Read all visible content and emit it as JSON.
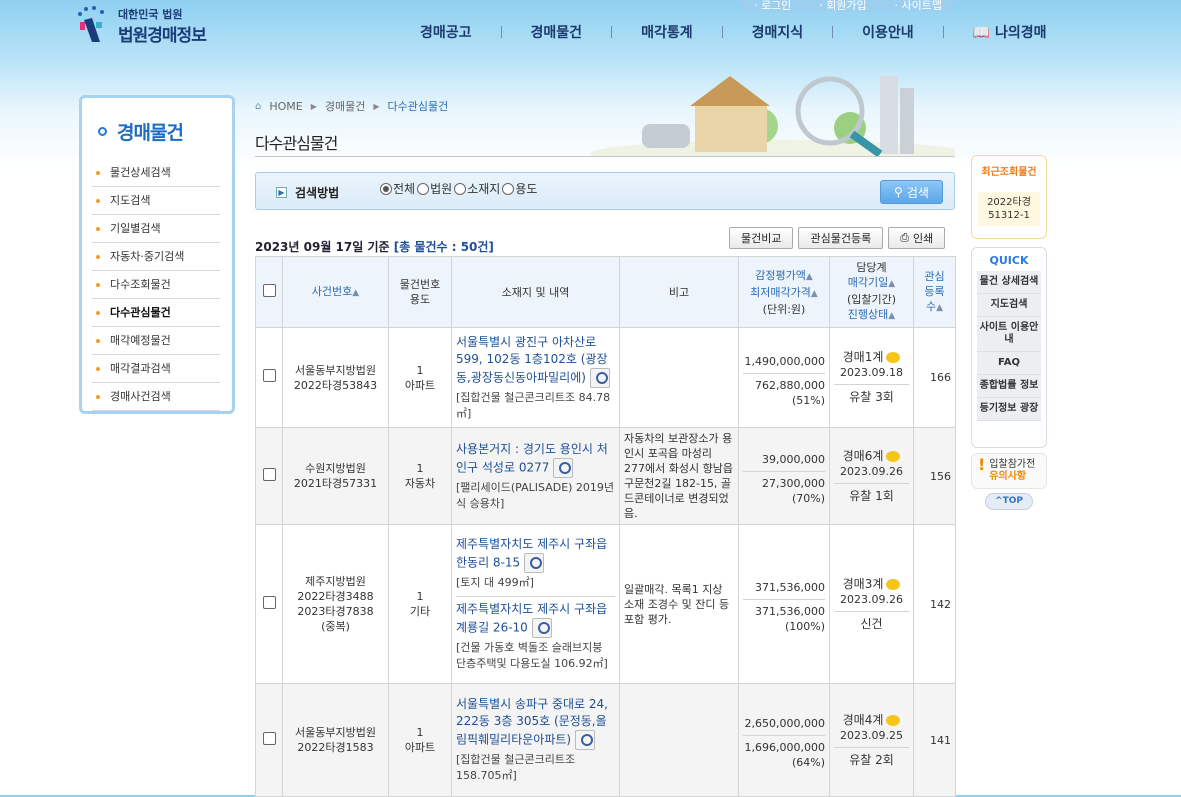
{
  "header": {
    "logo_small": "대한민국 법원",
    "logo_big": "법원경매정보",
    "top_links": [
      "로그인",
      "회원가입",
      "사이트맵"
    ],
    "nav": [
      "경매공고",
      "경매물건",
      "매각통계",
      "경매지식",
      "이용안내",
      "나의경매"
    ]
  },
  "sidebar": {
    "title": "경매물건",
    "items": [
      "물건상세검색",
      "지도검색",
      "기일별검색",
      "자동차·중기검색",
      "다수조회물건",
      "다수관심물건",
      "매각예정물건",
      "매각결과검색",
      "경매사건검색"
    ],
    "active_index": 5
  },
  "breadcrumb": [
    "HOME",
    "경매물건",
    "다수관심물건"
  ],
  "page_title": "다수관심물건",
  "search": {
    "label": "검색방법",
    "options": [
      "전체",
      "법원",
      "소재지",
      "용도"
    ],
    "selected": "전체",
    "button": "검색"
  },
  "summary": {
    "date": "2023년 09월 17일 기준",
    "count": "[총 물건수 : 50건]"
  },
  "actions": {
    "compare": "물건비교",
    "register": "관심물건등록",
    "print": "인쇄"
  },
  "table": {
    "headers": {
      "case": "사건번호",
      "item_no": "물건번호",
      "use": "용도",
      "location": "소재지 및 내역",
      "note": "비고",
      "appraisal": "감정평가액",
      "min_price": "최저매각가격",
      "unit": "(단위:원)",
      "dept": "담당계",
      "sale_date": "매각기일",
      "period": "(입찰기간)",
      "status": "진행상태",
      "interest": "관심",
      "interest2": "등록",
      "interest3": "수"
    },
    "rows": [
      {
        "court": "서울동부지방법원",
        "case_nos": [
          "2022타경53843"
        ],
        "item_no": "1",
        "use": "아파트",
        "locations": [
          {
            "addr": "서울특별시 광진구 아차산로 599, 102동 1층102호 (광장동,광장동신동아파밀리에)",
            "desc": "[집합건물 철근콘크리트조 84.78㎡]"
          }
        ],
        "note": "",
        "appraisal": "1,490,000,000",
        "min_price": "762,880,000",
        "ratio": "(51%)",
        "dept": "경매1계",
        "date": "2023.09.18",
        "status": "유찰 3회",
        "interest": "166"
      },
      {
        "court": "수원지방법원",
        "case_nos": [
          "2021타경57331"
        ],
        "item_no": "1",
        "use": "자동차",
        "locations": [
          {
            "addr": "사용본거지 : 경기도 용인시 처인구 석성로 0277",
            "desc": "[팰리세이드(PALISADE) 2019년식 승용차]"
          }
        ],
        "note": "자동차의 보관장소가 용인시 포곡읍 마성리 277에서 화성시 향남읍 구문천2길 182-15, 골드콘테이너로 변경되었음.",
        "appraisal": "39,000,000",
        "min_price": "27,300,000",
        "ratio": "(70%)",
        "dept": "경매6계",
        "date": "2023.09.26",
        "status": "유찰 1회",
        "interest": "156"
      },
      {
        "court": "제주지방법원",
        "case_nos": [
          "2022타경3488",
          "2023타경7838",
          "(중복)"
        ],
        "item_no": "1",
        "use": "기타",
        "locations": [
          {
            "addr": "제주특별자치도 제주시 구좌읍 한동리 8-15",
            "desc": "[토지 대 499㎡]"
          },
          {
            "addr": "제주특별자치도 제주시 구좌읍 계룡길 26-10",
            "desc": "[건물 가동호 벽돌조 슬래브지붕 단층주택및 다용도실 106.92㎡]"
          }
        ],
        "note": "일괄매각. 목록1 지상 소재 조경수 및 잔디 등 포함 평가.",
        "appraisal": "371,536,000",
        "min_price": "371,536,000",
        "ratio": "(100%)",
        "dept": "경매3계",
        "date": "2023.09.26",
        "status": "신건",
        "interest": "142"
      },
      {
        "court": "서울동부지방법원",
        "case_nos": [
          "2022타경1583"
        ],
        "item_no": "1",
        "use": "아파트",
        "locations": [
          {
            "addr": "서울특별시 송파구 중대로 24, 222동 3층 305호 (문정동,올림픽훼밀리타운아파트)",
            "desc": "[집합건물 철근콘크리트조 158.705㎡]"
          }
        ],
        "note": "",
        "appraisal": "2,650,000,000",
        "min_price": "1,696,000,000",
        "ratio": "(64%)",
        "dept": "경매4계",
        "date": "2023.09.25",
        "status": "유찰 2회",
        "interest": "141"
      }
    ]
  },
  "right": {
    "recent_title": "최근조회물건",
    "recent_value": "2022타경 51312-1",
    "quick_title": "QUICK",
    "quick_items": [
      "물건 상세검색",
      "지도검색",
      "사이트 이용안내",
      "FAQ",
      "종합법률 정보",
      "등기정보 광장"
    ],
    "notice_line1": "입찰참가전",
    "notice_line2": "유의사항",
    "top": "^TOP"
  },
  "colors": {
    "accent": "#1d6cc0",
    "link": "#1d4f96",
    "orange": "#f07a1a"
  }
}
